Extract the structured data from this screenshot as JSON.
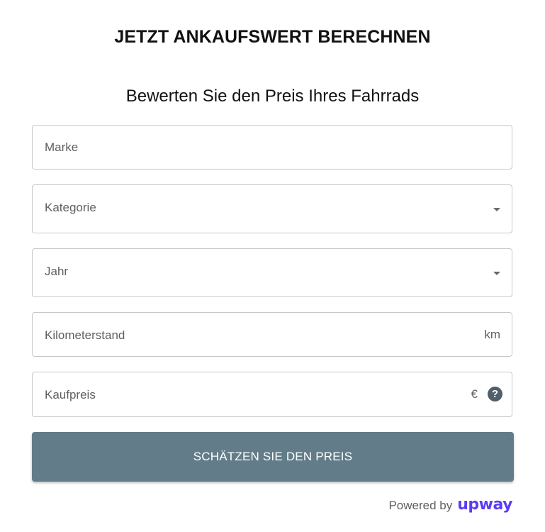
{
  "header": {
    "title": "JETZT ANKAUFSWERT BERECHNEN",
    "subtitle": "Bewerten Sie den Preis Ihres Fahrrads"
  },
  "form": {
    "brand": {
      "label": "Marke"
    },
    "category": {
      "label": "Kategorie",
      "icon": "caret-down-icon"
    },
    "year": {
      "label": "Jahr",
      "icon": "caret-down-icon"
    },
    "mileage": {
      "label": "Kilometerstand",
      "unit": "km"
    },
    "purchase_price": {
      "label": "Kaufpreis",
      "unit": "€",
      "help": "?"
    },
    "submit_label": "SCHÄTZEN SIE DEN PREIS"
  },
  "footer": {
    "powered_by": "Powered by",
    "brand": "upway"
  },
  "colors": {
    "button": "#627d89",
    "brand": "#5b3df5",
    "help_icon": "#4f5f6b"
  }
}
